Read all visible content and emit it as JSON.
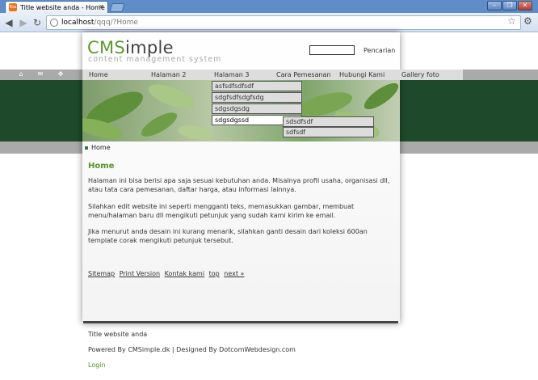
{
  "browser": {
    "tab_title": "Title website anda - Home",
    "tab_favicon": "Rss",
    "url_host": "localhost",
    "url_path": "/qqq/?Home",
    "window_minimize": "–",
    "window_maximize": "❐",
    "window_close": "✕"
  },
  "site": {
    "logo_prefix": "CMS",
    "logo_suffix": "imple",
    "tagline": "content management system",
    "search_button": "Pencarian",
    "search_value": ""
  },
  "menu": {
    "items": [
      "Home",
      "Halaman 2",
      "Halaman 3",
      "Cara Pemesanan",
      "Hubungi Kami",
      "Gallery foto"
    ]
  },
  "submenu": {
    "level1": [
      "asfsdfsdfsdf",
      "sdgfsdfsdgfsdg",
      "sdgsdgsdg",
      "sdgsdgssd"
    ],
    "level2": [
      "sdsdfsdf",
      "sdfsdf"
    ]
  },
  "breadcrumb": "Home",
  "content": {
    "heading": "Home",
    "paragraphs": [
      "Halaman ini bisa berisi apa saja sesuai kebutuhan anda. Misalnya profil usaha, organisasi dll, atau tata cara pemesanan, daftar harga, atau informasi lainnya.",
      "Silahkan edit website ini seperti mengganti teks, memasukkan gambar, membuat menu/halaman baru dll mengikuti petunjuk yang sudah kami kirim ke email.",
      "Jika menurut anda desain ini kurang menarik, silahkan ganti desain dari koleksi 600an template corak mengikuti petunjuk tersebut."
    ]
  },
  "footer": {
    "links": [
      "Sitemap",
      "Print Version",
      "Kontak kami",
      "top",
      "next »"
    ],
    "site_title": "Title website anda",
    "powered_by": "Powered By CMSimple.dk | Designed By DotcomWebdesign.com",
    "login": "Login"
  },
  "colors": {
    "accent_green": "#5b8f2b",
    "banner_dark": "#1e4a2b",
    "chrome_blue": "#5f8dc7"
  }
}
